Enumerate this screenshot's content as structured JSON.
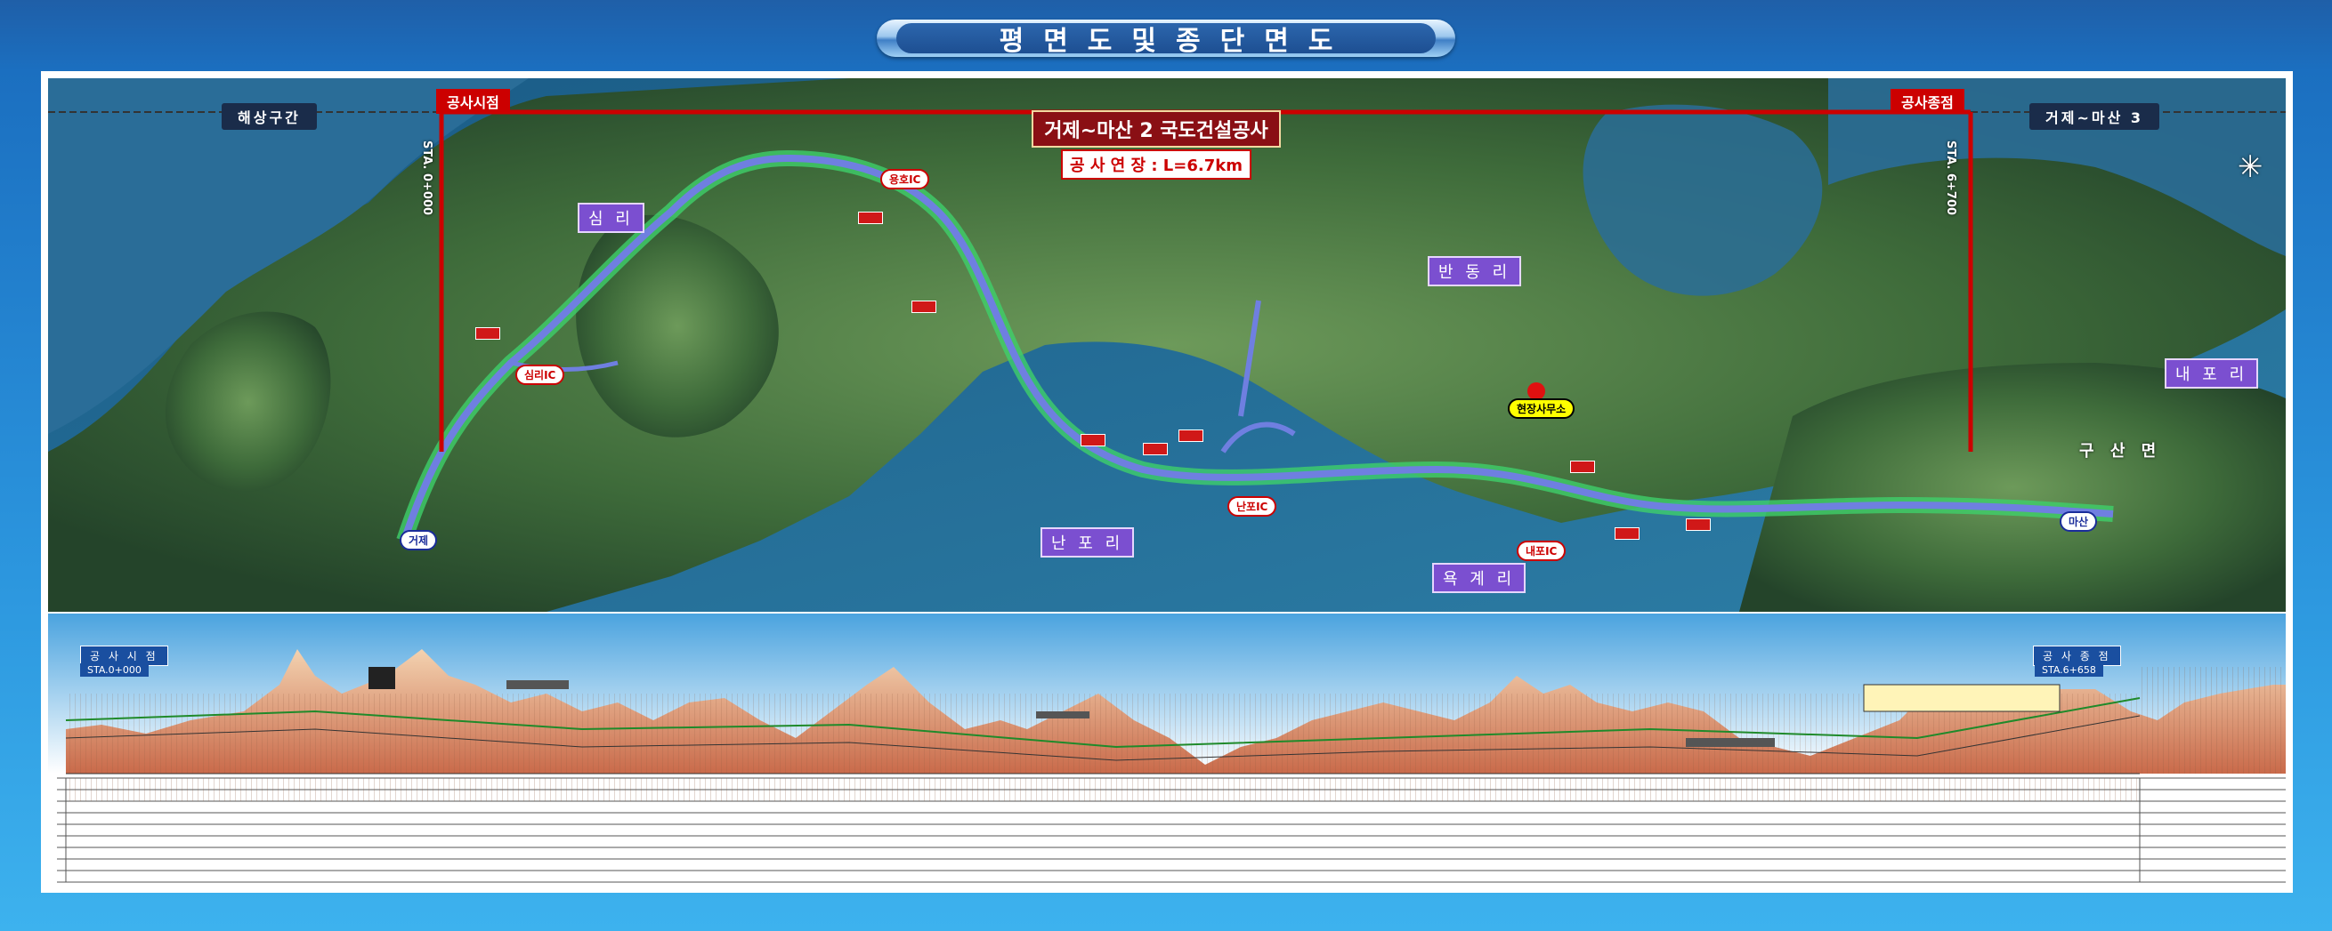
{
  "title": "평면도및종단면도",
  "top_bar": {
    "left_section": "해상구간",
    "right_section": "거제~마산 3",
    "start_label": "공사시점",
    "end_label": "공사종점",
    "project_name": "거제~마산 2 국도건설공사",
    "length": "공 사 연 장 : L=6.7km",
    "start_sta": "STA. 0+000",
    "end_sta": "STA. 6+700"
  },
  "places": {
    "simri": "심 리",
    "nampo": "난 포 리",
    "yukgye": "욕 계 리",
    "banbyeong": "반 동 리",
    "naepo": "내 포 리",
    "gusan": "구 산 면",
    "office": "현장사무소",
    "masan": "마산",
    "geoje": "거제"
  },
  "ic_tags": [
    "심리IC",
    "용호IC",
    "난포IC",
    "내포IC"
  ],
  "profile": {
    "start_label": "공 사 시 점",
    "start_sta": "STA.0+000",
    "end_label": "공 사 종 점",
    "end_sta": "STA.6+658"
  },
  "colors": {
    "road": "#6f7fe0",
    "earthwork": "#3fd06a",
    "banner_red": "#c00",
    "soil": "#d8896a",
    "sky": "#bfe0f4"
  }
}
